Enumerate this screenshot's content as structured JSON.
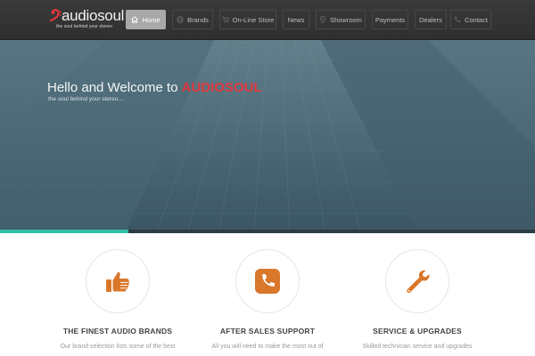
{
  "brand": {
    "name": "audiosoul",
    "tagline": "the soul behind your stereo",
    "accent_color": "#e2363c"
  },
  "nav": {
    "items": [
      {
        "label": "Home",
        "icon": "home-icon",
        "active": true
      },
      {
        "label": "Brands",
        "icon": "globe-icon",
        "active": false
      },
      {
        "label": "On-Line Store",
        "icon": "cart-icon",
        "active": false
      },
      {
        "label": "News",
        "icon": "",
        "active": false
      },
      {
        "label": "Showroom",
        "icon": "location-icon",
        "active": false
      },
      {
        "label": "Payments",
        "icon": "",
        "active": false
      },
      {
        "label": "Dealers",
        "icon": "",
        "active": false
      },
      {
        "label": "Contact",
        "icon": "phone-icon",
        "active": false
      }
    ]
  },
  "hero": {
    "title_prefix": "Hello and Welcome to ",
    "title_brand": "AUDIOSOUL",
    "subtitle": "the soul behind your stereo....",
    "progress": 0.24,
    "progress_color": "#2fbfa6"
  },
  "features": [
    {
      "icon": "thumbs-up-icon",
      "title": "THE FINEST AUDIO BRANDS",
      "text": "Our brand selection lists some of the best",
      "color": "#d9772b"
    },
    {
      "icon": "phone-icon",
      "title": "AFTER SALES SUPPORT",
      "text": "All you will need to make the most out of",
      "color": "#d9772b"
    },
    {
      "icon": "wrench-icon",
      "title": "SERVICE & UPGRADES",
      "text": "Skilled technician service and upgrades",
      "color": "#d9772b"
    }
  ]
}
